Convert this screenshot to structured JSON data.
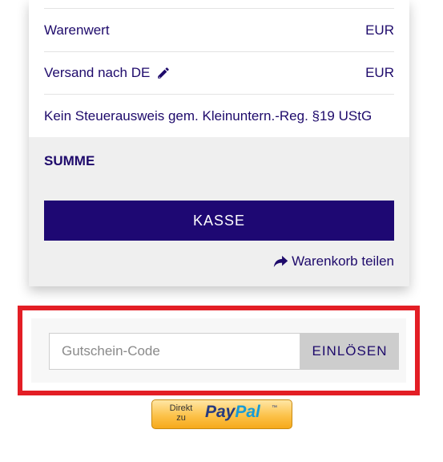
{
  "summary": {
    "rows": [
      {
        "label": "Warenwert",
        "value": "EUR"
      },
      {
        "label": "Versand nach DE",
        "value": "EUR"
      },
      {
        "label": "Kein Steuerausweis gem. Kleinuntern.-Reg. §19 UStG"
      }
    ],
    "total_label": "SUMME",
    "checkout_button": "KASSE",
    "share_link": "Warenkorb teilen"
  },
  "voucher": {
    "placeholder": "Gutschein-Code",
    "value": "",
    "redeem_button": "EINLÖSEN"
  },
  "paypal": {
    "small_line1": "Direkt",
    "small_line2": "zu",
    "logo_part1": "Pay",
    "logo_part2": "Pal",
    "logo_tm": "™"
  },
  "colors": {
    "brand": "#1e0873",
    "text": "#1e0a6b",
    "highlight_border": "#e31e25",
    "summary_bg": "#efefef"
  },
  "icons": {
    "edit": "pencil-icon",
    "share": "share-arrow-icon"
  }
}
